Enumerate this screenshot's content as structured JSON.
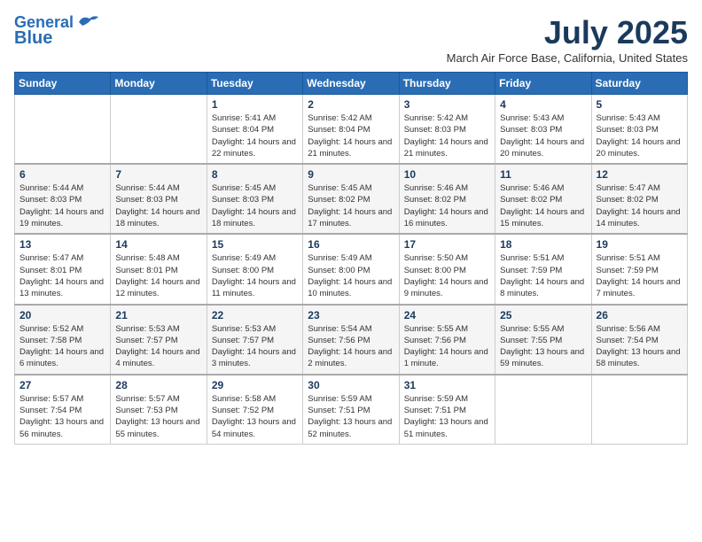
{
  "header": {
    "logo_line1": "General",
    "logo_line2": "Blue",
    "month_title": "July 2025",
    "subtitle": "March Air Force Base, California, United States"
  },
  "weekdays": [
    "Sunday",
    "Monday",
    "Tuesday",
    "Wednesday",
    "Thursday",
    "Friday",
    "Saturday"
  ],
  "weeks": [
    [
      {
        "day": "",
        "info": ""
      },
      {
        "day": "",
        "info": ""
      },
      {
        "day": "1",
        "info": "Sunrise: 5:41 AM\nSunset: 8:04 PM\nDaylight: 14 hours and 22 minutes."
      },
      {
        "day": "2",
        "info": "Sunrise: 5:42 AM\nSunset: 8:04 PM\nDaylight: 14 hours and 21 minutes."
      },
      {
        "day": "3",
        "info": "Sunrise: 5:42 AM\nSunset: 8:03 PM\nDaylight: 14 hours and 21 minutes."
      },
      {
        "day": "4",
        "info": "Sunrise: 5:43 AM\nSunset: 8:03 PM\nDaylight: 14 hours and 20 minutes."
      },
      {
        "day": "5",
        "info": "Sunrise: 5:43 AM\nSunset: 8:03 PM\nDaylight: 14 hours and 20 minutes."
      }
    ],
    [
      {
        "day": "6",
        "info": "Sunrise: 5:44 AM\nSunset: 8:03 PM\nDaylight: 14 hours and 19 minutes."
      },
      {
        "day": "7",
        "info": "Sunrise: 5:44 AM\nSunset: 8:03 PM\nDaylight: 14 hours and 18 minutes."
      },
      {
        "day": "8",
        "info": "Sunrise: 5:45 AM\nSunset: 8:03 PM\nDaylight: 14 hours and 18 minutes."
      },
      {
        "day": "9",
        "info": "Sunrise: 5:45 AM\nSunset: 8:02 PM\nDaylight: 14 hours and 17 minutes."
      },
      {
        "day": "10",
        "info": "Sunrise: 5:46 AM\nSunset: 8:02 PM\nDaylight: 14 hours and 16 minutes."
      },
      {
        "day": "11",
        "info": "Sunrise: 5:46 AM\nSunset: 8:02 PM\nDaylight: 14 hours and 15 minutes."
      },
      {
        "day": "12",
        "info": "Sunrise: 5:47 AM\nSunset: 8:02 PM\nDaylight: 14 hours and 14 minutes."
      }
    ],
    [
      {
        "day": "13",
        "info": "Sunrise: 5:47 AM\nSunset: 8:01 PM\nDaylight: 14 hours and 13 minutes."
      },
      {
        "day": "14",
        "info": "Sunrise: 5:48 AM\nSunset: 8:01 PM\nDaylight: 14 hours and 12 minutes."
      },
      {
        "day": "15",
        "info": "Sunrise: 5:49 AM\nSunset: 8:00 PM\nDaylight: 14 hours and 11 minutes."
      },
      {
        "day": "16",
        "info": "Sunrise: 5:49 AM\nSunset: 8:00 PM\nDaylight: 14 hours and 10 minutes."
      },
      {
        "day": "17",
        "info": "Sunrise: 5:50 AM\nSunset: 8:00 PM\nDaylight: 14 hours and 9 minutes."
      },
      {
        "day": "18",
        "info": "Sunrise: 5:51 AM\nSunset: 7:59 PM\nDaylight: 14 hours and 8 minutes."
      },
      {
        "day": "19",
        "info": "Sunrise: 5:51 AM\nSunset: 7:59 PM\nDaylight: 14 hours and 7 minutes."
      }
    ],
    [
      {
        "day": "20",
        "info": "Sunrise: 5:52 AM\nSunset: 7:58 PM\nDaylight: 14 hours and 6 minutes."
      },
      {
        "day": "21",
        "info": "Sunrise: 5:53 AM\nSunset: 7:57 PM\nDaylight: 14 hours and 4 minutes."
      },
      {
        "day": "22",
        "info": "Sunrise: 5:53 AM\nSunset: 7:57 PM\nDaylight: 14 hours and 3 minutes."
      },
      {
        "day": "23",
        "info": "Sunrise: 5:54 AM\nSunset: 7:56 PM\nDaylight: 14 hours and 2 minutes."
      },
      {
        "day": "24",
        "info": "Sunrise: 5:55 AM\nSunset: 7:56 PM\nDaylight: 14 hours and 1 minute."
      },
      {
        "day": "25",
        "info": "Sunrise: 5:55 AM\nSunset: 7:55 PM\nDaylight: 13 hours and 59 minutes."
      },
      {
        "day": "26",
        "info": "Sunrise: 5:56 AM\nSunset: 7:54 PM\nDaylight: 13 hours and 58 minutes."
      }
    ],
    [
      {
        "day": "27",
        "info": "Sunrise: 5:57 AM\nSunset: 7:54 PM\nDaylight: 13 hours and 56 minutes."
      },
      {
        "day": "28",
        "info": "Sunrise: 5:57 AM\nSunset: 7:53 PM\nDaylight: 13 hours and 55 minutes."
      },
      {
        "day": "29",
        "info": "Sunrise: 5:58 AM\nSunset: 7:52 PM\nDaylight: 13 hours and 54 minutes."
      },
      {
        "day": "30",
        "info": "Sunrise: 5:59 AM\nSunset: 7:51 PM\nDaylight: 13 hours and 52 minutes."
      },
      {
        "day": "31",
        "info": "Sunrise: 5:59 AM\nSunset: 7:51 PM\nDaylight: 13 hours and 51 minutes."
      },
      {
        "day": "",
        "info": ""
      },
      {
        "day": "",
        "info": ""
      }
    ]
  ]
}
